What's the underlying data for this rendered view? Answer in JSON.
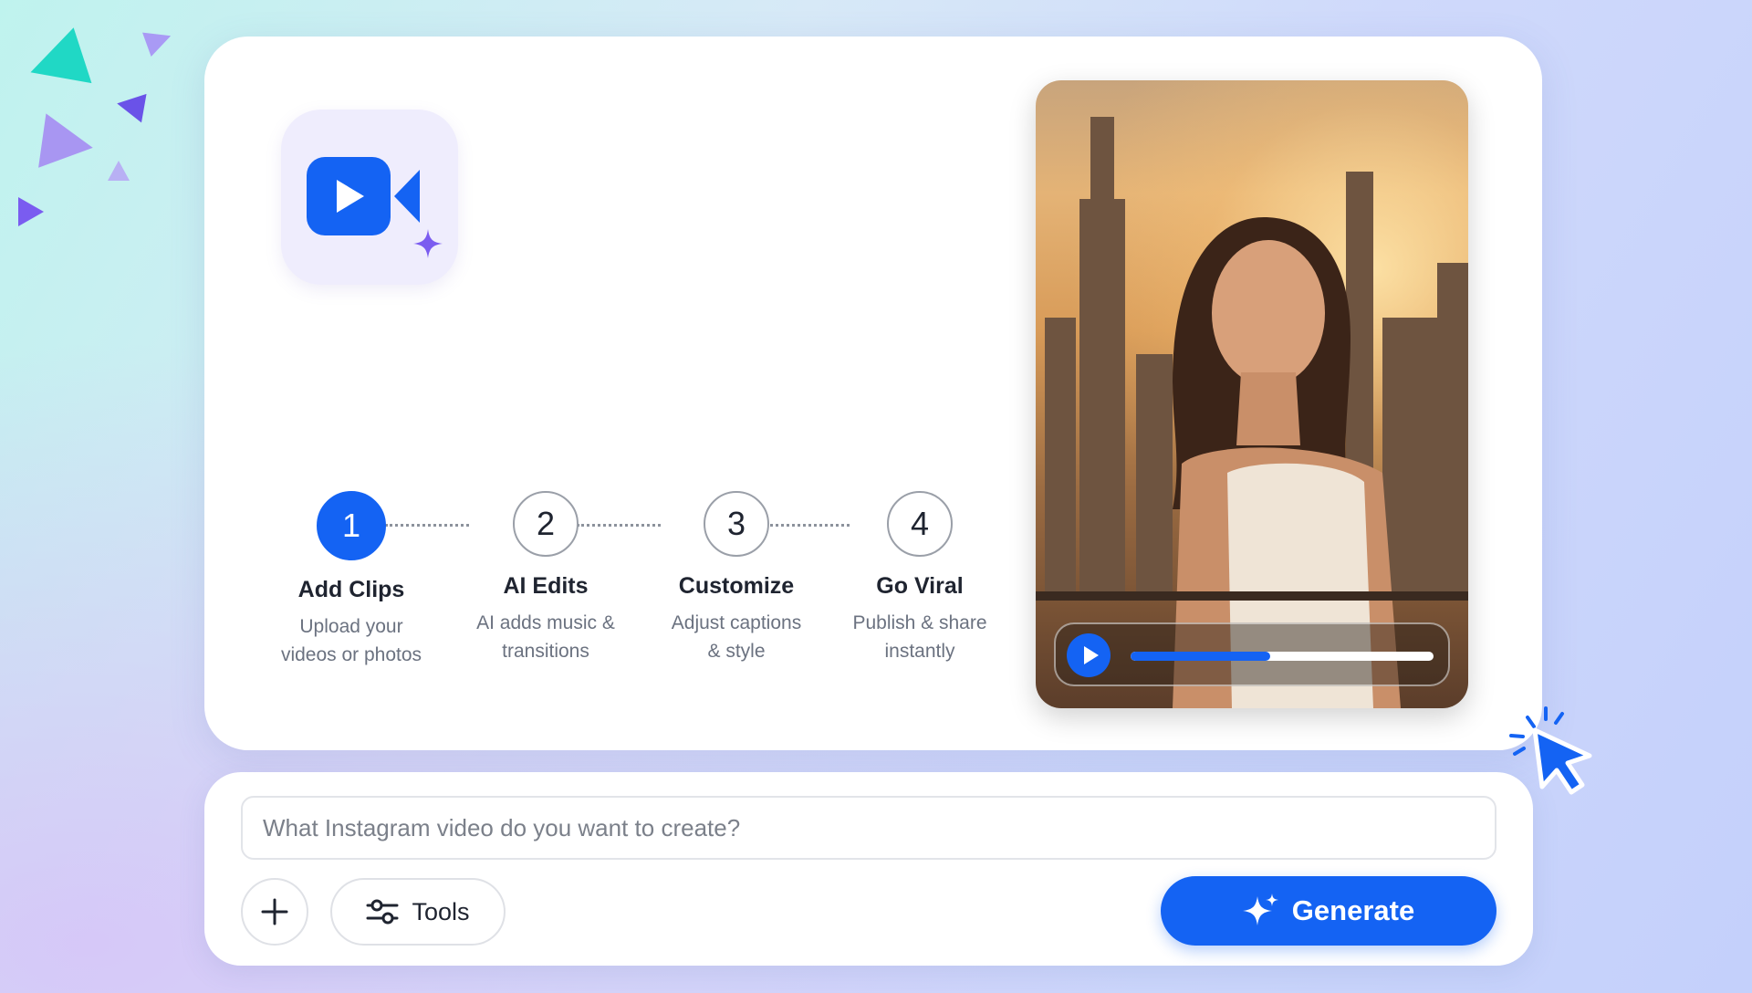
{
  "colors": {
    "accent": "#1463f3",
    "sparkle": "#7b5cf0",
    "teal": "#1ed9c7",
    "violet": "#8a6cf2"
  },
  "steps": [
    {
      "number": "1",
      "title": "Add Clips",
      "desc": "Upload your\nvideos or photos",
      "active": true
    },
    {
      "number": "2",
      "title": "AI Edits",
      "desc": "AI adds music &\ntransitions",
      "active": false
    },
    {
      "number": "3",
      "title": "Customize",
      "desc": "Adjust captions\n&  style",
      "active": false
    },
    {
      "number": "4",
      "title": "Go Viral",
      "desc": "Publish & share\ninstantly",
      "active": false
    }
  ],
  "player": {
    "progress": 0.46
  },
  "prompt": {
    "placeholder": "What Instagram video do you want to create?"
  },
  "toolbar": {
    "tools_label": "Tools",
    "generate_label": "Generate"
  },
  "icons": {
    "app": "video-camera-icon",
    "sparkle": "sparkle-icon",
    "play": "play-icon",
    "add": "plus-icon",
    "tools": "sliders-icon",
    "generate": "sparkles-icon",
    "cursor": "cursor-click-icon"
  }
}
